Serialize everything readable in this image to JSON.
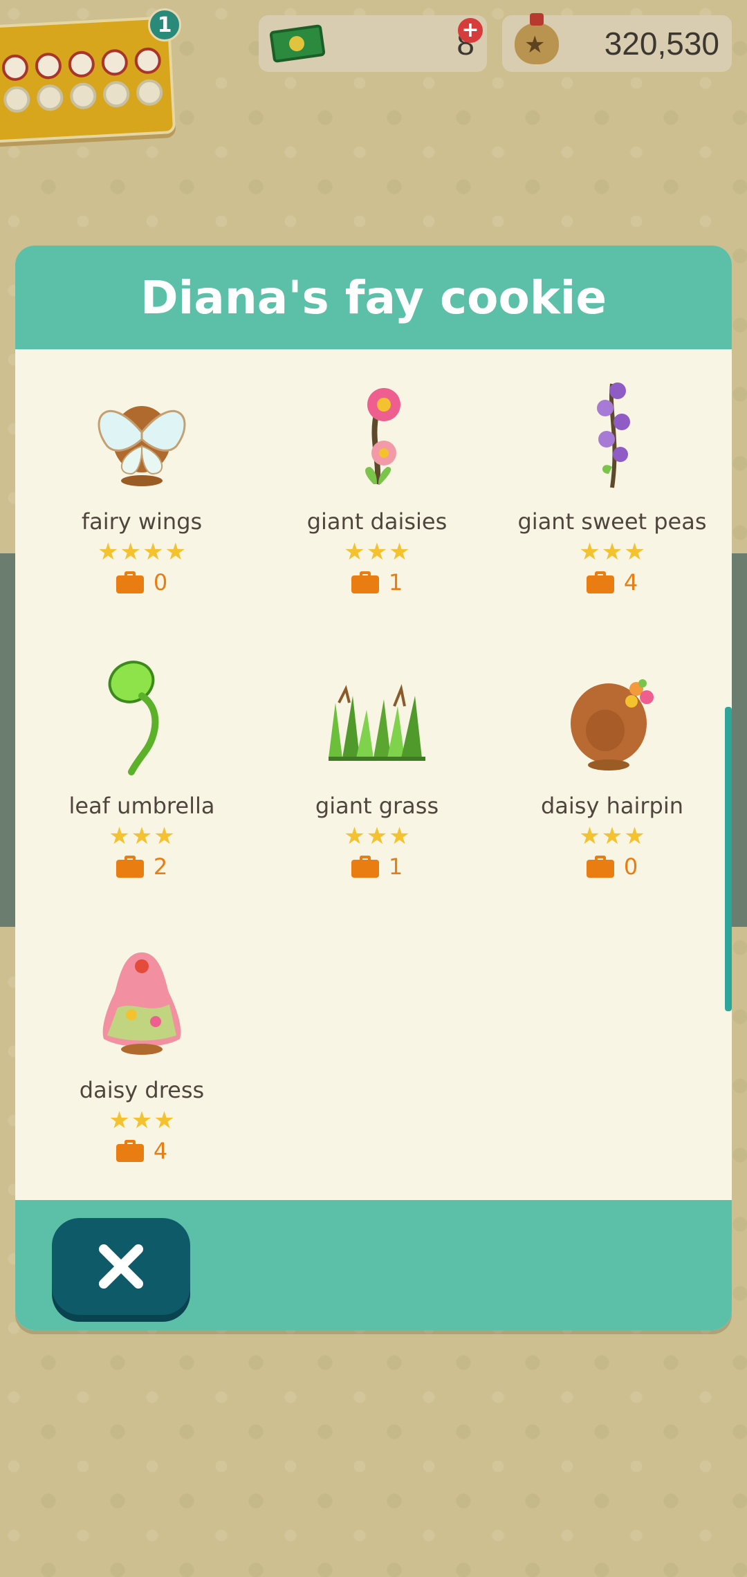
{
  "hud": {
    "ticket_badge": "1",
    "leaf_tickets": "8",
    "plus_icon": "+",
    "bells": "320,530"
  },
  "modal": {
    "title": "Diana's fay cookie",
    "items": [
      {
        "name": "fairy wings",
        "stars": 4,
        "count": "0",
        "icon": "fairy-wings-icon"
      },
      {
        "name": "giant daisies",
        "stars": 3,
        "count": "1",
        "icon": "giant-daisies-icon"
      },
      {
        "name": "giant sweet peas",
        "stars": 3,
        "count": "4",
        "icon": "giant-sweet-peas-icon"
      },
      {
        "name": "leaf umbrella",
        "stars": 3,
        "count": "2",
        "icon": "leaf-umbrella-icon"
      },
      {
        "name": "giant grass",
        "stars": 3,
        "count": "1",
        "icon": "giant-grass-icon"
      },
      {
        "name": "daisy hairpin",
        "stars": 3,
        "count": "0",
        "icon": "daisy-hairpin-icon"
      },
      {
        "name": "daisy dress",
        "stars": 3,
        "count": "4",
        "icon": "daisy-dress-icon"
      }
    ],
    "close_icon": "close-icon"
  },
  "colors": {
    "header": "#5cbfa8",
    "body": "#f9f5e4",
    "star": "#f3c22e",
    "count": "#ea7d12",
    "close_button": "#0e5a68"
  }
}
